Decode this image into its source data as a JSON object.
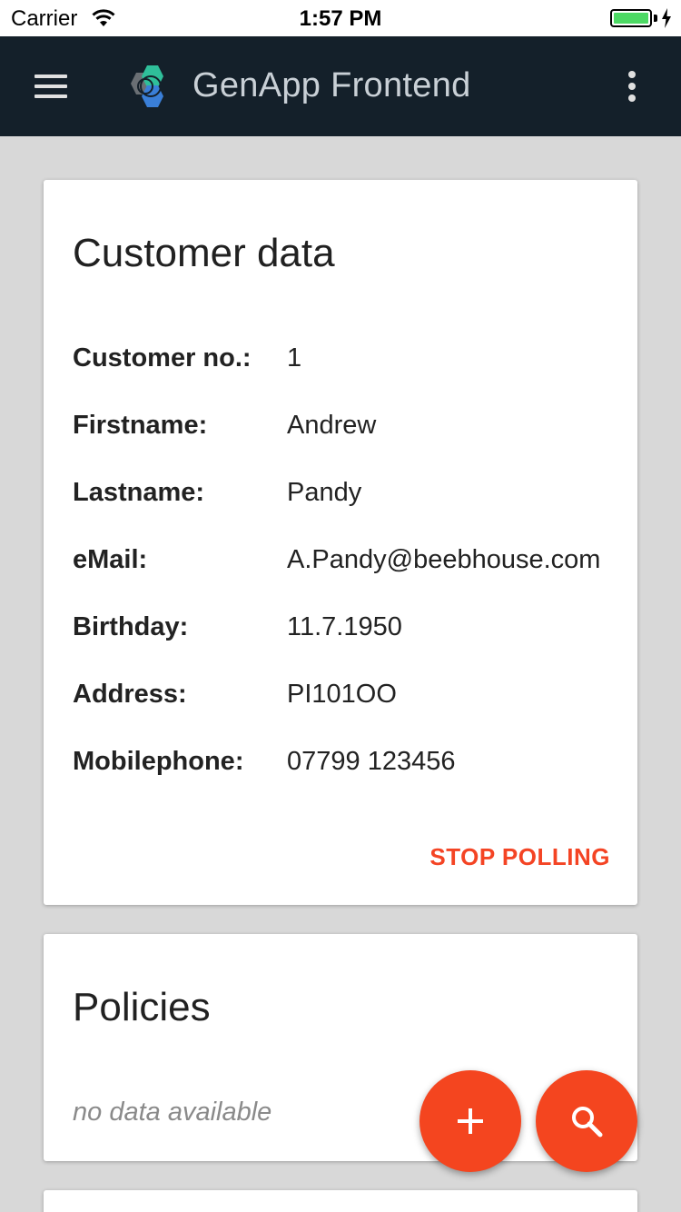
{
  "status_bar": {
    "carrier": "Carrier",
    "time": "1:57 PM",
    "battery_color": "#4cd964"
  },
  "app_bar": {
    "title": "GenApp Frontend",
    "menu_icon": "hamburger-menu-icon",
    "logo_icon": "hexagon-logo-icon",
    "more_icon": "vertical-dots-icon",
    "background": "#14202a"
  },
  "customer_card": {
    "title": "Customer data",
    "fields": [
      {
        "label": "Customer no.:",
        "value": "1"
      },
      {
        "label": "Firstname:",
        "value": "Andrew"
      },
      {
        "label": "Lastname:",
        "value": "Pandy"
      },
      {
        "label": "eMail:",
        "value": "A.Pandy@beebhouse.com"
      },
      {
        "label": "Birthday:",
        "value": "11.7.1950"
      },
      {
        "label": "Address:",
        "value": "PI101OO"
      },
      {
        "label": "Mobilephone:",
        "value": "07799 123456"
      }
    ],
    "action_label": "STOP POLLING",
    "accent_color": "#f44424"
  },
  "policies_card": {
    "title": "Policies",
    "empty_text": "no data available"
  },
  "fabs": {
    "add_icon": "plus-icon",
    "search_icon": "search-icon",
    "color": "#f4451f"
  }
}
